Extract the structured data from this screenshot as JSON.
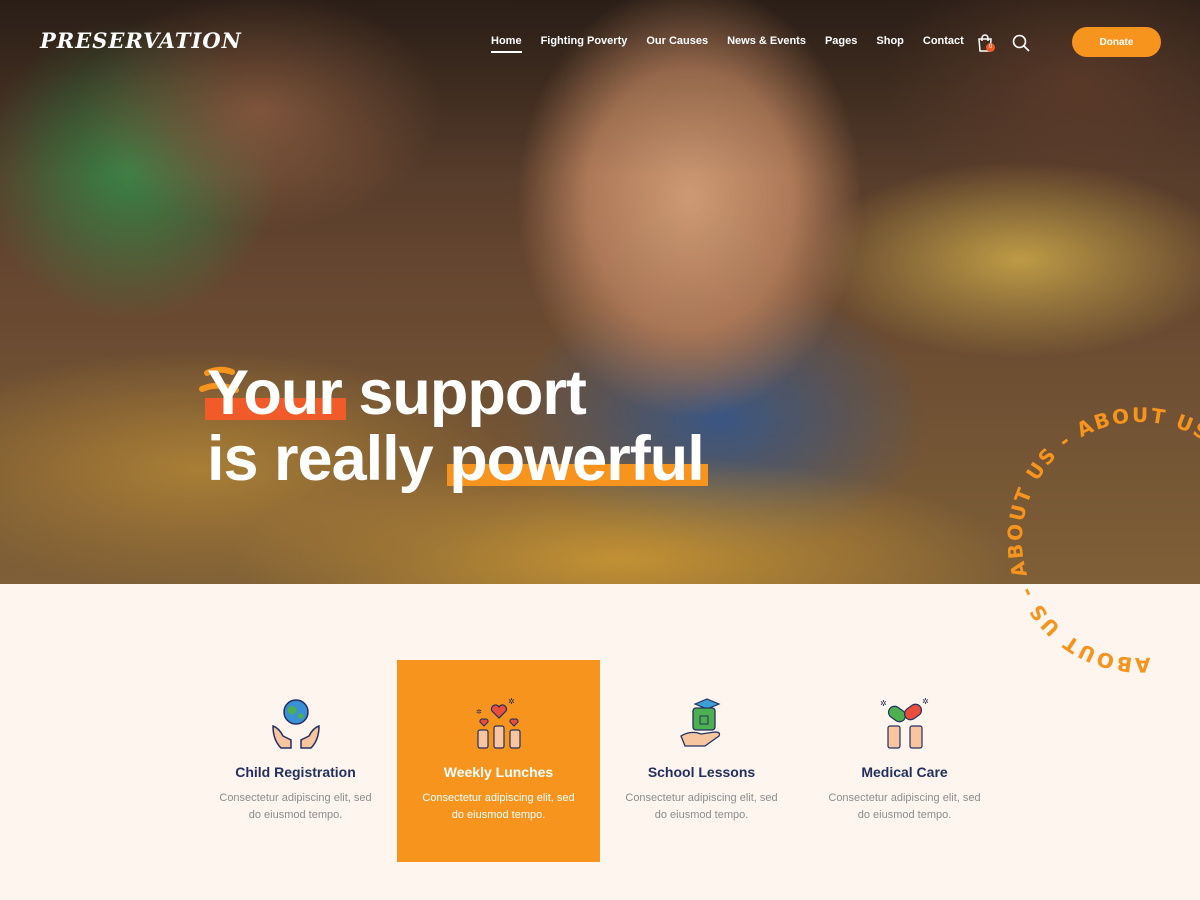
{
  "brand": {
    "logo": "Preservation"
  },
  "nav": {
    "items": [
      {
        "label": "Home",
        "active": true
      },
      {
        "label": "Fighting Poverty",
        "active": false
      },
      {
        "label": "Our Causes",
        "active": false
      },
      {
        "label": "News & Events",
        "active": false
      },
      {
        "label": "Pages",
        "active": false
      },
      {
        "label": "Shop",
        "active": false
      },
      {
        "label": "Contact",
        "active": false
      }
    ],
    "cart_count": "0",
    "cart_icon": "shopping-bag-icon",
    "search_icon": "search-icon",
    "donate_label": "Donate"
  },
  "hero": {
    "line1_highlight": "Your",
    "line1_rest": "support",
    "line2_rest": "is really",
    "line2_highlight": "powerful",
    "badge_text": "ABOUT US - ABOUT US - ABOUT US - "
  },
  "features": [
    {
      "title": "Child Registration",
      "desc_line1": "Consectetur adipiscing elit, sed",
      "desc_line2": "do eiusmod tempo.",
      "icon": "globe-hands-icon",
      "active": false
    },
    {
      "title": "Weekly Lunches",
      "desc_line1": "Consectetur adipiscing elit, sed",
      "desc_line2": "do eiusmod tempo.",
      "icon": "hearts-hands-icon",
      "active": true
    },
    {
      "title": "School Lessons",
      "desc_line1": "Consectetur adipiscing elit, sed",
      "desc_line2": "do eiusmod tempo.",
      "icon": "graduation-hand-icon",
      "active": false
    },
    {
      "title": "Medical Care",
      "desc_line1": "Consectetur adipiscing elit, sed",
      "desc_line2": "do eiusmod tempo.",
      "icon": "pills-hands-icon",
      "active": false
    }
  ],
  "colors": {
    "accent": "#f7941d",
    "accent_red": "#f15a29",
    "navy": "#23305f",
    "cream": "#fdf5ee"
  }
}
